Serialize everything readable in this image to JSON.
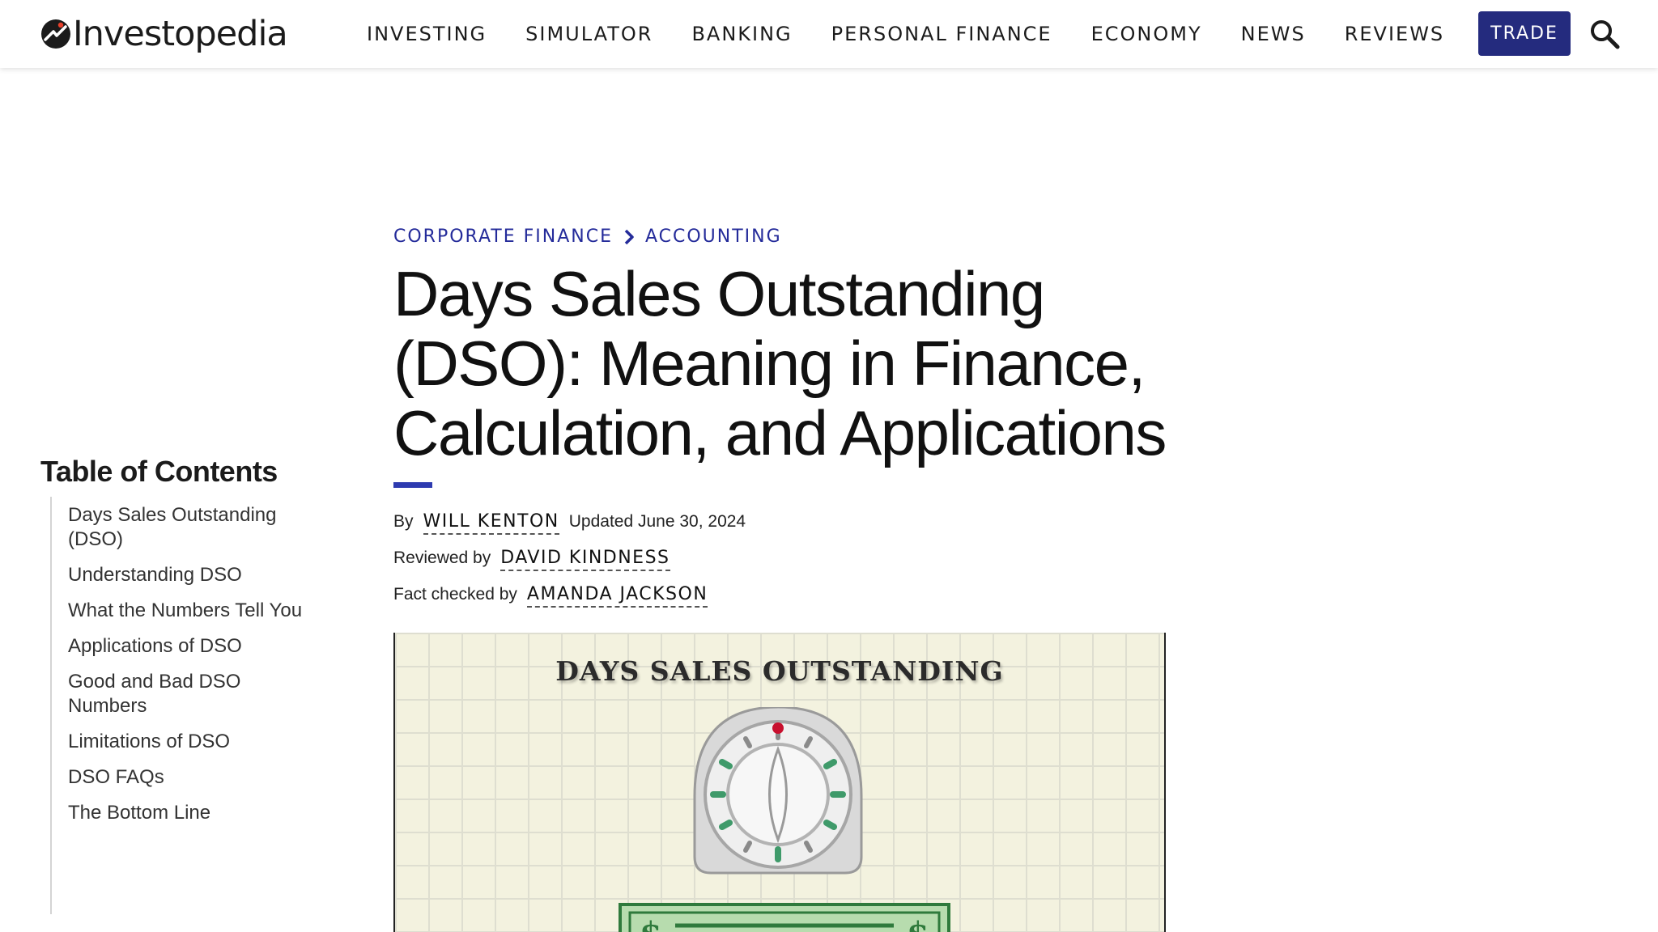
{
  "site": {
    "logo_text": "Investopedia",
    "nav": [
      "INVESTING",
      "SIMULATOR",
      "BANKING",
      "PERSONAL FINANCE",
      "ECONOMY",
      "NEWS",
      "REVIEWS"
    ],
    "trade_label": "TRADE",
    "search_icon": "search-icon",
    "brand_color": "#242b7e"
  },
  "toc": {
    "title": "Table of Contents",
    "items": [
      "Days Sales Outstanding (DSO)",
      "Understanding DSO",
      "What the Numbers Tell You",
      "Applications of DSO",
      "Good and Bad DSO Numbers",
      "Limitations of DSO",
      "DSO FAQs",
      "The Bottom Line"
    ]
  },
  "article": {
    "breadcrumb": [
      "CORPORATE FINANCE",
      "ACCOUNTING"
    ],
    "title": "Days Sales Outstanding (DSO): Meaning in Finance, Calculation, and Applications",
    "byline": {
      "by_label": "By",
      "author": "WILL KENTON",
      "updated": "Updated June 30, 2024",
      "reviewed_label": "Reviewed by",
      "reviewer": "DAVID KINDNESS",
      "fact_label": "Fact checked by",
      "fact_checker": "AMANDA JACKSON"
    },
    "hero": {
      "title": "DAYS SALES OUTSTANDING",
      "timer_icon": "kitchen-timer-icon",
      "bill_icon": "dollar-bill-icon"
    },
    "accent_color": "#2e3bb0"
  }
}
